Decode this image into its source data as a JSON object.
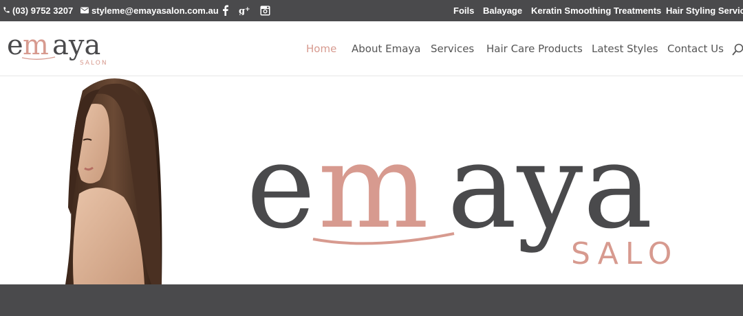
{
  "topbar": {
    "phone": "(03) 9752 3207",
    "email": "styleme@emayasalon.com.au",
    "social_icons": [
      "facebook-icon",
      "google-plus-icon",
      "instagram-icon"
    ],
    "links": [
      "Foils",
      "Balayage",
      "Keratin Smoothing Treatments",
      "Hair Styling Services"
    ]
  },
  "logo": {
    "word_e": "e",
    "word_m": "m",
    "word_aya": "aya",
    "sub": "SALON"
  },
  "nav": {
    "items": [
      "Home",
      "About Emaya",
      "Services",
      "Hair Care Products",
      "Latest Styles",
      "Contact Us"
    ],
    "active": "Home"
  },
  "hero": {
    "logo_e": "e",
    "logo_m": "m",
    "logo_aya": "aya",
    "logo_sub": "SALON"
  },
  "colors": {
    "dark": "#4a4a4c",
    "accent": "#d79a8f",
    "text": "#555555"
  }
}
